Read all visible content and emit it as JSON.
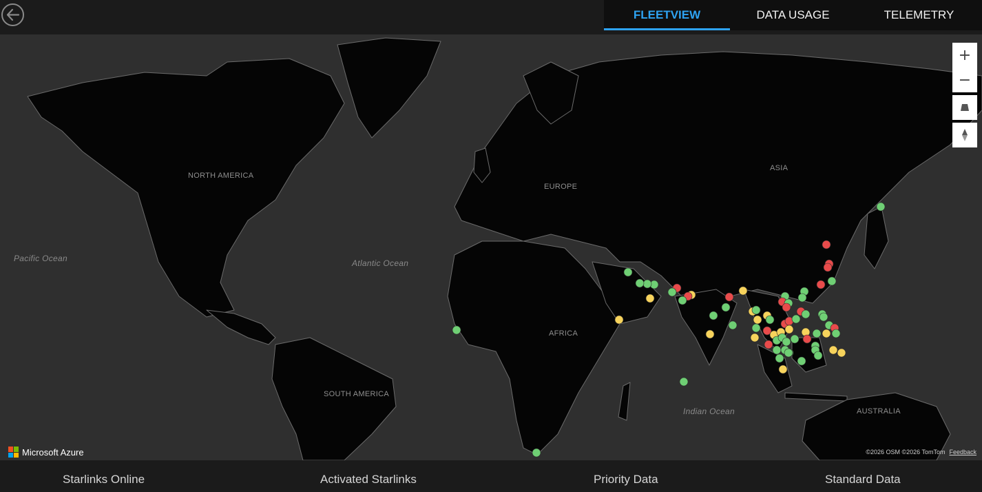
{
  "header": {
    "tabs": [
      {
        "label": "FLEETVIEW",
        "active": true
      },
      {
        "label": "DATA USAGE",
        "active": false
      },
      {
        "label": "TELEMETRY",
        "active": false
      }
    ]
  },
  "map": {
    "continent_labels": [
      "NORTH AMERICA",
      "EUROPE",
      "ASIA",
      "AFRICA",
      "SOUTH AMERICA",
      "AUSTRALIA"
    ],
    "ocean_labels": [
      "Pacific Ocean",
      "Atlantic Ocean",
      "Indian Ocean"
    ],
    "controls": [
      "zoom-in",
      "zoom-out",
      "pitch",
      "compass"
    ],
    "brand": "Microsoft Azure",
    "attribution": "©2026 OSM  ©2026 TomTom",
    "feedback": "Feedback",
    "status_colors": {
      "online": "#6fcf74",
      "warning": "#f7d35c",
      "offline": "#e84b4b"
    },
    "marker_counts": {
      "green": 58,
      "yellow": 20,
      "red": 16
    }
  },
  "stats": {
    "labels": [
      "Starlinks Online",
      "Activated Starlinks",
      "Priority Data",
      "Standard Data"
    ]
  }
}
